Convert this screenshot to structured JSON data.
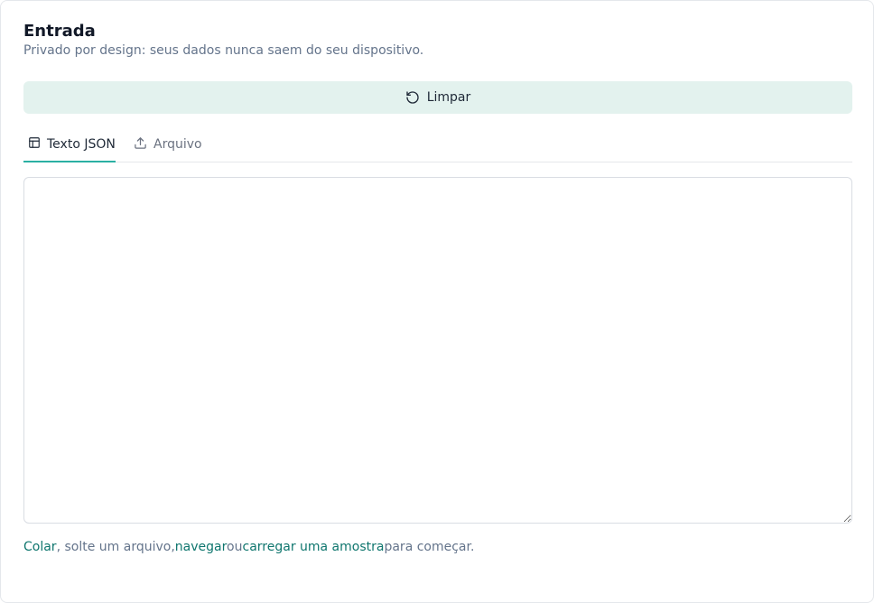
{
  "header": {
    "title": "Entrada",
    "subtitle": "Privado por design: seus dados nunca saem do seu dispositivo."
  },
  "actions": {
    "clear_label": "Limpar",
    "clear_icon": "rotate-ccw-icon"
  },
  "tabs": [
    {
      "label": "Texto JSON",
      "icon": "table-icon",
      "active": true
    },
    {
      "label": "Arquivo",
      "icon": "upload-icon",
      "active": false
    }
  ],
  "editor": {
    "value": "",
    "placeholder": ""
  },
  "hint": {
    "paste_link": "Colar",
    "text_1": ", solte um arquivo,",
    "browse_link": "navegar",
    "text_2": "ou",
    "sample_link": "carregar uma amostra",
    "text_3": "para começar."
  },
  "colors": {
    "accent": "#2bb0a3",
    "button_bg": "#e3f2ee",
    "link": "#0f766e",
    "muted": "#64748b"
  }
}
